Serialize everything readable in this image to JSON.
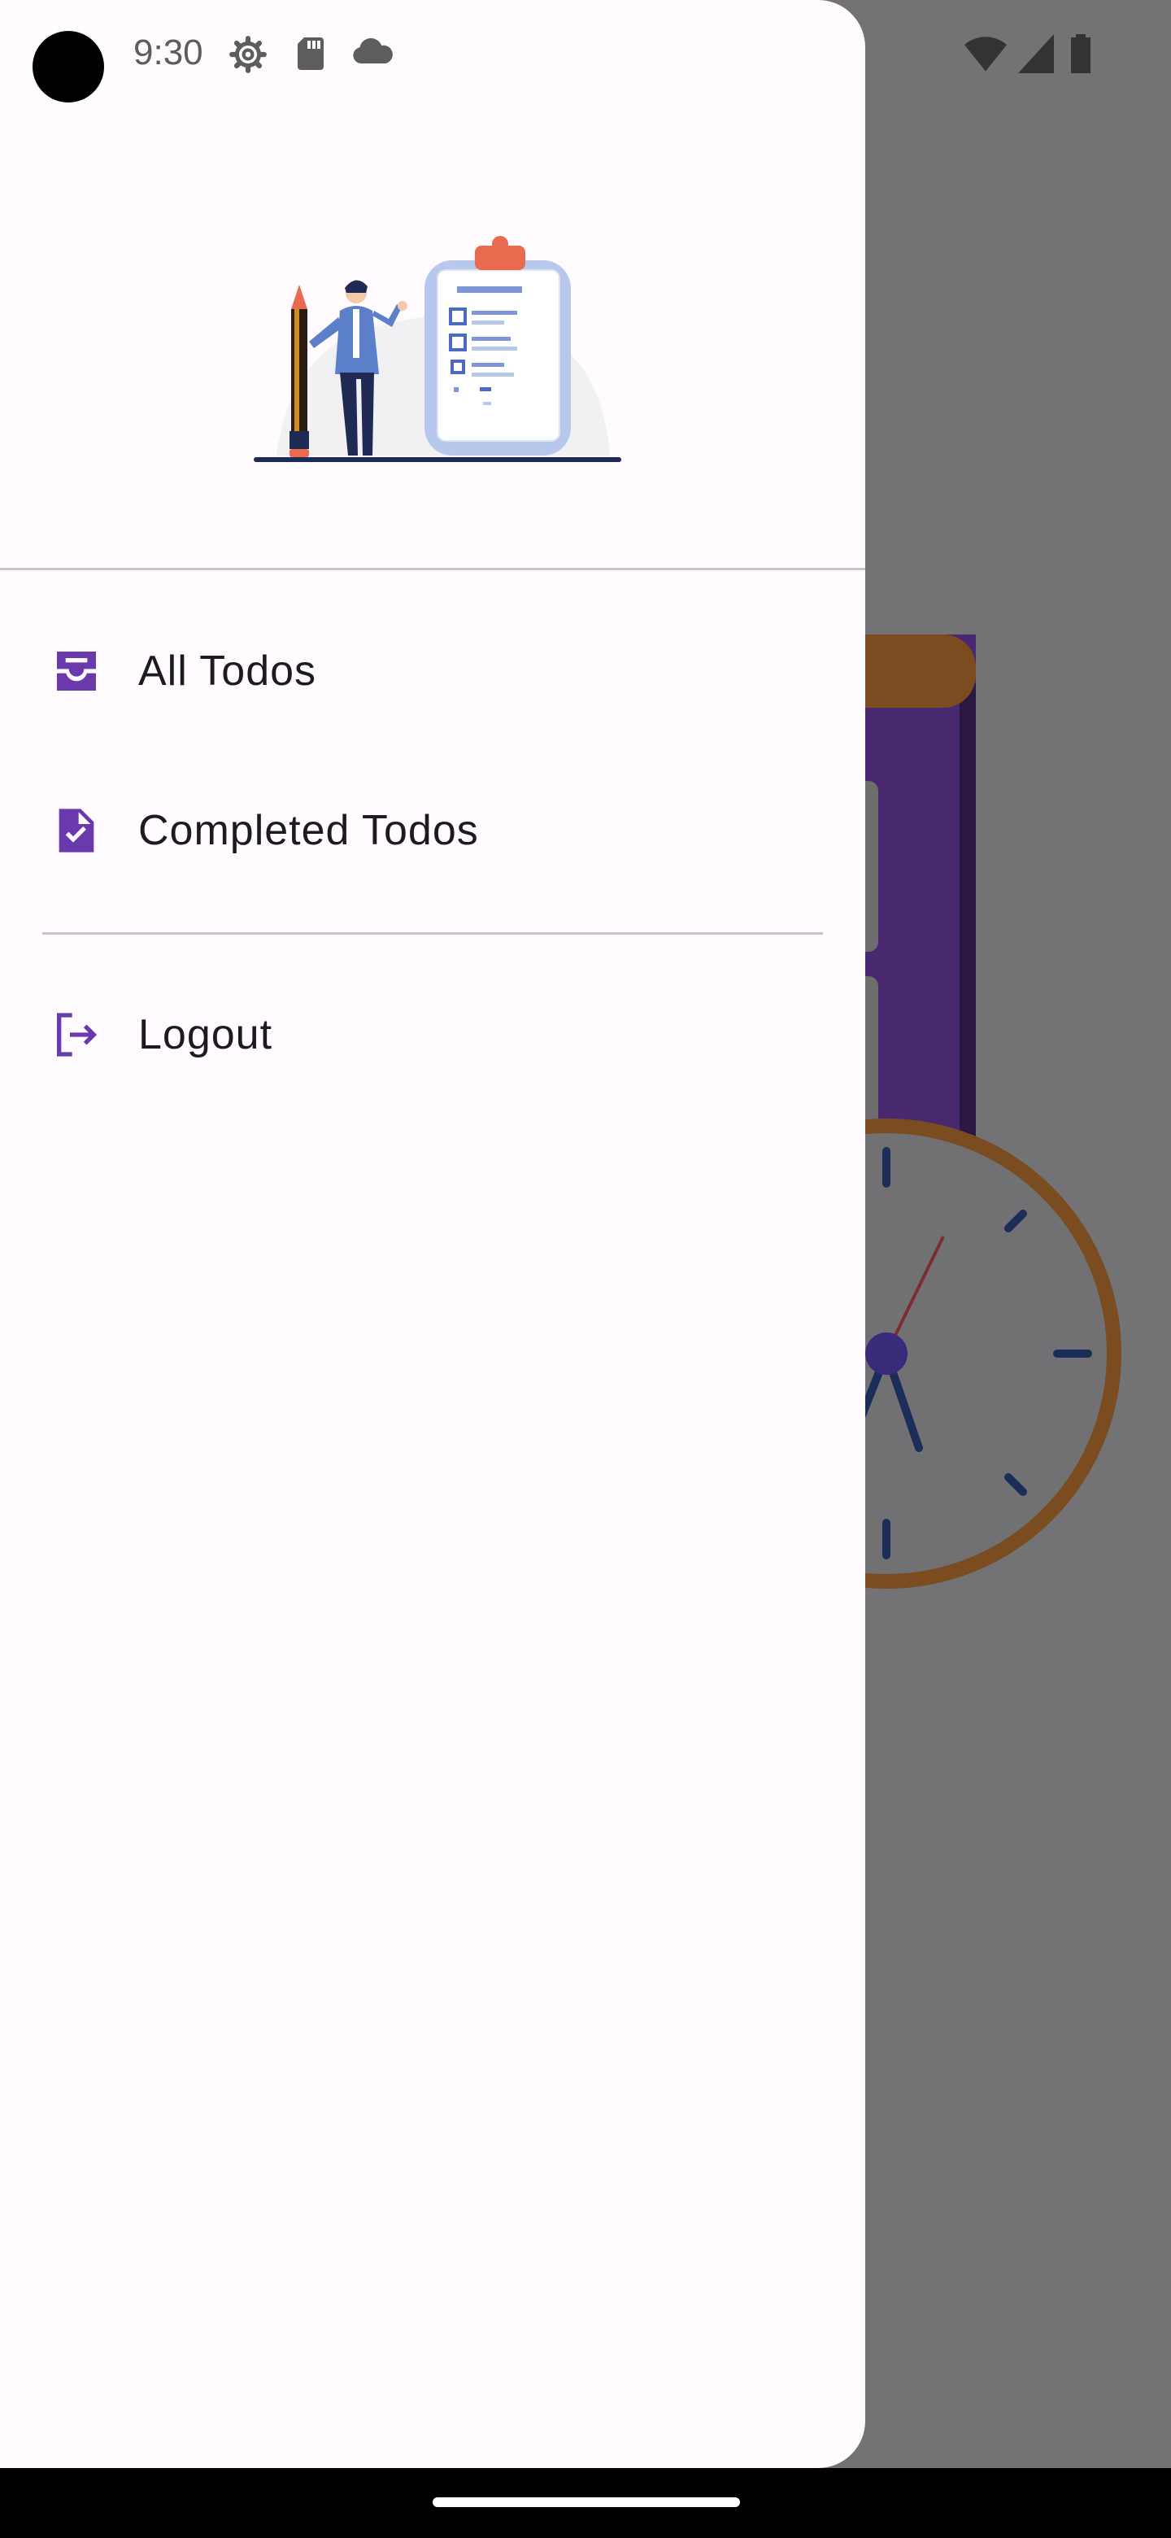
{
  "status_bar": {
    "time": "9:30",
    "icons": [
      "settings-icon",
      "sd-card-icon",
      "cloud-icon",
      "wifi-icon",
      "signal-icon",
      "battery-icon"
    ]
  },
  "drawer": {
    "header_image": "todo-checklist-illustration",
    "items": [
      {
        "label": "All Todos",
        "icon": "inbox-icon"
      },
      {
        "label": "Completed Todos",
        "icon": "document-check-icon"
      }
    ],
    "secondary_items": [
      {
        "label": "Logout",
        "icon": "logout-icon"
      }
    ]
  },
  "colors": {
    "accent": "#6a3aad",
    "drawer_bg": "#fffbfe",
    "scrim": "#737274",
    "divider": "#c9c5ca",
    "bg_purple": "#48296f",
    "bg_brown": "#7a4c1f"
  }
}
